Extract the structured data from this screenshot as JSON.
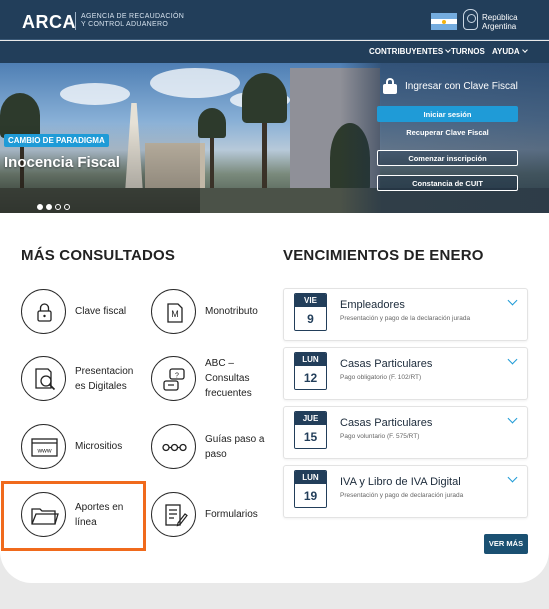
{
  "header": {
    "logo": "ARCA",
    "agency_line1": "AGENCIA DE RECAUDACIÓN",
    "agency_line2": "Y CONTROL ADUANERO",
    "gov_line1": "República",
    "gov_line2": "Argentina",
    "icons": [
      "argentina-flag-icon",
      "national-seal-icon"
    ]
  },
  "nav": {
    "items": [
      {
        "label": "CONTRIBUYENTES",
        "dropdown": true
      },
      {
        "label": "TURNOS",
        "dropdown": false
      },
      {
        "label": "AYUDA",
        "dropdown": true
      }
    ]
  },
  "hero": {
    "badge": "CAMBIO DE PARADIGMA",
    "title": "Inocencia Fiscal",
    "slides": 4,
    "active_slide": 1,
    "login": {
      "title": "Ingresar con Clave Fiscal",
      "primary_button": "Iniciar sesión",
      "recover_link": "Recuperar Clave Fiscal",
      "start_button": "Comenzar inscripción",
      "cuit_button": "Constancia de CUIT"
    }
  },
  "most_consulted": {
    "title": "MÁS CONSULTADOS",
    "items": [
      {
        "line1": "Clave fiscal",
        "line2": "",
        "line3": "",
        "icon": "lock-icon"
      },
      {
        "line1": "Monotributo",
        "line2": "",
        "line3": "",
        "icon": "monotributo-icon"
      },
      {
        "line1": "Presentacion",
        "line2": "es Digitales",
        "line3": "",
        "icon": "document-search-icon"
      },
      {
        "line1": "ABC –",
        "line2": "Consultas",
        "line3": "frecuentes",
        "icon": "faq-chat-icon"
      },
      {
        "line1": "Micrositios",
        "line2": "",
        "line3": "",
        "icon": "www-browser-icon"
      },
      {
        "line1": "Guías paso a",
        "line2": "paso",
        "line3": "",
        "icon": "steps-icon"
      },
      {
        "line1": "Aportes en",
        "line2": "línea",
        "line3": "",
        "icon": "folder-icon"
      },
      {
        "line1": "Formularios",
        "line2": "",
        "line3": "",
        "icon": "form-edit-icon"
      }
    ]
  },
  "deadlines": {
    "title": "VENCIMIENTOS DE ENERO",
    "items": [
      {
        "day": "VIE",
        "date": "9",
        "title": "Empleadores",
        "subtitle": "Presentación y pago de la declaración jurada"
      },
      {
        "day": "LUN",
        "date": "12",
        "title": "Casas Particulares",
        "subtitle": "Pago obligatorio (F. 102/RT)"
      },
      {
        "day": "JUE",
        "date": "15",
        "title": "Casas Particulares",
        "subtitle": "Pago voluntario (F. 575/RT)"
      },
      {
        "day": "LUN",
        "date": "19",
        "title": "IVA y Libro de IVA Digital",
        "subtitle": "Presentación y pago de declaración jurada"
      }
    ],
    "more_button": "VER MÁS"
  },
  "colors": {
    "header_bg": "#223e5a",
    "accent": "#1f9bd7",
    "highlight": "#f06a1c",
    "button_dark": "#1a5072"
  }
}
